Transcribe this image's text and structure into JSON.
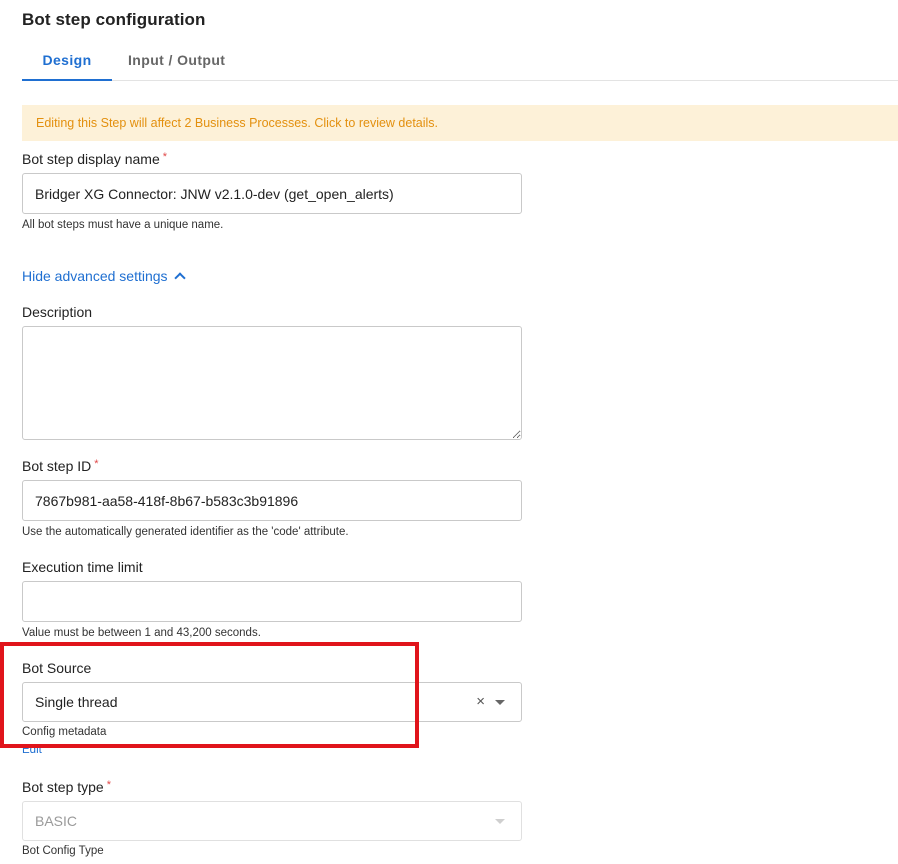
{
  "page": {
    "title": "Bot step configuration"
  },
  "tabs": [
    {
      "label": "Design",
      "active": true
    },
    {
      "label": "Input / Output",
      "active": false
    }
  ],
  "banner": {
    "text": "Editing this Step will affect 2 Business Processes. Click to review details."
  },
  "fields": {
    "display_name": {
      "label": "Bot step display name",
      "required_mark": "*",
      "value": "Bridger XG Connector: JNW v2.1.0-dev (get_open_alerts)",
      "help": "All bot steps must have a unique name."
    },
    "advanced_toggle": {
      "label": "Hide advanced settings"
    },
    "description": {
      "label": "Description",
      "value": ""
    },
    "step_id": {
      "label": "Bot step ID",
      "required_mark": "*",
      "value": "7867b981-aa58-418f-8b67-b583c3b91896",
      "help": "Use the automatically generated identifier as the 'code' attribute."
    },
    "time_limit": {
      "label": "Execution time limit",
      "value": "",
      "help": "Value must be between 1 and 43,200 seconds."
    },
    "bot_source": {
      "label": "Bot Source",
      "value": "Single thread",
      "clear_glyph": "×",
      "help": "Config metadata",
      "edit_link": "Edit"
    },
    "step_type": {
      "label": "Bot step type",
      "required_mark": "*",
      "value": "BASIC",
      "help": "Bot Config Type"
    }
  },
  "colors": {
    "accent": "#1f6fd1",
    "banner_bg": "#fdf1d8",
    "banner_text": "#e3900f",
    "required": "#e04848",
    "highlight": "#e0141b"
  }
}
